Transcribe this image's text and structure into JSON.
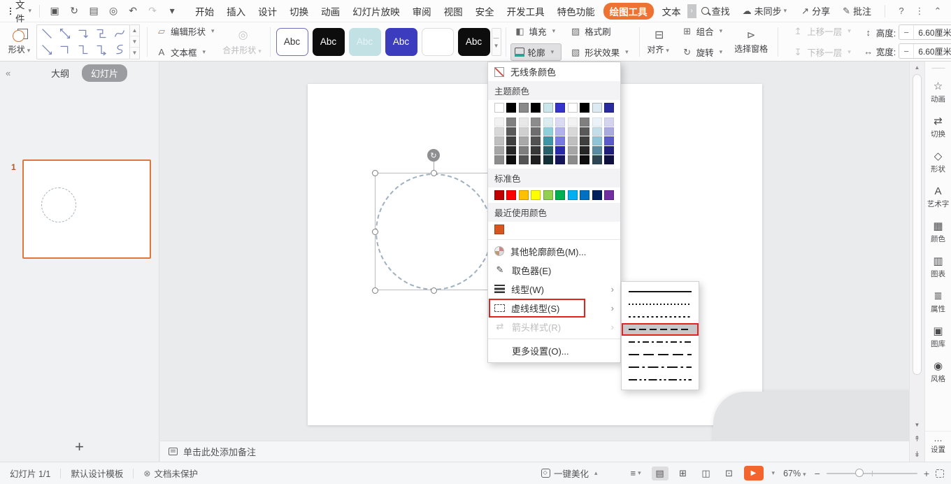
{
  "menubar": {
    "file": "文件",
    "quick_icons": [
      {
        "name": "save-icon",
        "glyph": "▣"
      },
      {
        "name": "export-icon",
        "glyph": "↻"
      },
      {
        "name": "print-icon",
        "glyph": "▤"
      },
      {
        "name": "print-preview-icon",
        "glyph": "◎"
      },
      {
        "name": "undo-icon",
        "glyph": "↶"
      },
      {
        "name": "redo-icon",
        "glyph": "↷",
        "disabled": true
      },
      {
        "name": "more-commands-icon",
        "glyph": "▾"
      }
    ],
    "tabs": [
      {
        "label": "开始"
      },
      {
        "label": "插入"
      },
      {
        "label": "设计"
      },
      {
        "label": "切换"
      },
      {
        "label": "动画"
      },
      {
        "label": "幻灯片放映"
      },
      {
        "label": "审阅"
      },
      {
        "label": "视图"
      },
      {
        "label": "安全"
      },
      {
        "label": "开发工具"
      },
      {
        "label": "特色功能"
      },
      {
        "label": "绘图工具",
        "active": true
      },
      {
        "label": "文本",
        "truncated": true
      }
    ],
    "find": "查找",
    "sync": "未同步",
    "share": "分享",
    "comment": "批注"
  },
  "ribbon": {
    "shapes_label": "形状",
    "shape_gallery": [
      "diag-line",
      "diag-arrow",
      "diag-double-arrow",
      "elbow",
      "elbow-arrow",
      "zigzag",
      "zigzag2",
      "zigzag-arrow",
      "curve",
      "scribble"
    ],
    "edit_shape": "编辑形状",
    "text_box": "文本框",
    "merge_shapes": "合并形状",
    "abc_label": "Abc",
    "abc_styles": [
      {
        "bg": "#ffffff",
        "color": "#333333",
        "border": "#7070c0"
      },
      {
        "bg": "#0d0d0d",
        "color": "#ffffff",
        "border": "#0d0d0d"
      },
      {
        "bg": "#c2e1e5",
        "color": "#e6f3f5",
        "border": "#c2e1e5"
      },
      {
        "bg": "#3c3cbe",
        "color": "#ffffff",
        "border": "#3c3cbe"
      },
      {
        "bg": "#ffffff",
        "color": "#ffffff",
        "border": "#dcdcde"
      },
      {
        "bg": "#0d0d0d",
        "color": "#ffffff",
        "border": "#0d0d0d"
      }
    ],
    "fill": "填充",
    "outline": "轮廓",
    "format_painter": "格式刷",
    "shape_effects": "形状效果",
    "align": "对齐",
    "group": "组合",
    "rotate": "旋转",
    "selection_pane": "选择窗格",
    "bring_forward": "上移一层",
    "send_backward": "下移一层",
    "height_label": "高度:",
    "height_value": "6.60厘米",
    "width_label": "宽度:",
    "width_value": "6.60厘米",
    "controls": {
      "minus": "−",
      "plus": "+"
    }
  },
  "left_panel": {
    "collapse": "«",
    "outline_tab": "大纲",
    "slides_tab": "幻灯片",
    "slide_number": "1",
    "add_label": "+"
  },
  "outline_menu": {
    "no_line": "无线条颜色",
    "theme_label": "主题颜色",
    "theme_colors": [
      "#FFFFFF",
      "#000000",
      "#8A8A8A",
      "#000000",
      "#C9E6EB",
      "#3734CC",
      "#FFFFFF",
      "#000000",
      "#DCEAF2",
      "#2B2BA0"
    ],
    "theme_tints": [
      [
        "#F2F2F2",
        "#7F7F7F",
        "#E8E8E8",
        "#8C8C8C",
        "#DBEDF0",
        "#DADAF5",
        "#F2F2F2",
        "#7F7F7F",
        "#EBF3F8",
        "#D4D4EF"
      ],
      [
        "#D8D8D8",
        "#595959",
        "#D0D0D0",
        "#6E6E6E",
        "#8FCFDA",
        "#B1B1EC",
        "#D8D8D8",
        "#595959",
        "#C3DDE9",
        "#AAAADF"
      ],
      [
        "#BFBFBF",
        "#3F3F3F",
        "#A8A8A8",
        "#525252",
        "#3E95A5",
        "#7878E1",
        "#BFBFBF",
        "#3F3F3F",
        "#8FC3D6",
        "#5A5AC8"
      ],
      [
        "#A6A6A6",
        "#262626",
        "#7E7E7E",
        "#383838",
        "#27616C",
        "#2A2AA8",
        "#A6A6A6",
        "#262626",
        "#5B8BA1",
        "#20207A"
      ],
      [
        "#8C8C8C",
        "#0D0D0D",
        "#545454",
        "#1F1F1F",
        "#123036",
        "#15155A",
        "#8C8C8C",
        "#0D0D0D",
        "#2E4654",
        "#10103E"
      ]
    ],
    "standard_label": "标准色",
    "standard_colors": [
      "#C00000",
      "#FE0000",
      "#FFC000",
      "#FFFF00",
      "#92D050",
      "#00B050",
      "#00B0F0",
      "#0070C0",
      "#002060",
      "#7030A0"
    ],
    "recent_label": "最近使用颜色",
    "recent_colors": [
      "#D7551F"
    ],
    "items": [
      {
        "label": "其他轮廓颜色(M)...",
        "icon": "color-wheel-icon"
      },
      {
        "label": "取色器(E)",
        "icon": "eyedropper-icon",
        "glyph": "✎"
      },
      {
        "label": "线型(W)",
        "icon": "line-weight-icon",
        "submenu": true
      },
      {
        "label": "虚线线型(S)",
        "icon": "dash-style-icon",
        "submenu": true,
        "highlighted": true
      },
      {
        "label": "箭头样式(R)",
        "icon": "arrow-style-icon",
        "glyph": "⇄",
        "submenu": true,
        "disabled": true
      },
      {
        "label": "更多设置(O)...",
        "icon": "none"
      }
    ]
  },
  "dash_submenu": {
    "styles": [
      {
        "name": "solid"
      },
      {
        "name": "round-dot"
      },
      {
        "name": "square-dot"
      },
      {
        "name": "dash",
        "selected": true
      },
      {
        "name": "dash-dot"
      },
      {
        "name": "long-dash"
      },
      {
        "name": "long-dash-dot"
      },
      {
        "name": "long-dash-dot-dot"
      }
    ]
  },
  "notes": {
    "placeholder": "单击此处添加备注"
  },
  "right_sidebar": {
    "items": [
      {
        "label": "动画",
        "icon": "animation-icon",
        "glyph": "☆"
      },
      {
        "label": "切换",
        "icon": "transition-icon",
        "glyph": "⇄"
      },
      {
        "label": "形状",
        "icon": "shape-icon",
        "glyph": "◇"
      },
      {
        "label": "艺术字",
        "icon": "wordart-icon",
        "glyph": "A"
      },
      {
        "label": "颜色",
        "icon": "color-icon",
        "glyph": "▦"
      },
      {
        "label": "图表",
        "icon": "chart-icon",
        "glyph": "▥"
      },
      {
        "label": "属性",
        "icon": "properties-icon",
        "glyph": "≣"
      },
      {
        "label": "图库",
        "icon": "gallery-icon",
        "glyph": "▣"
      },
      {
        "label": "风格",
        "icon": "style-icon",
        "glyph": "◉"
      }
    ],
    "settings": {
      "label": "设置",
      "glyph": "⋯"
    }
  },
  "statusbar": {
    "slide_counter": "幻灯片 1/1",
    "template": "默认设计模板",
    "protection": "文档未保护",
    "beautify": "一键美化",
    "zoom": "67%"
  },
  "colors": {
    "accent_orange": "#ee7231",
    "annotation_red": "#e2251b",
    "outline_teal": "#2f9e97"
  }
}
